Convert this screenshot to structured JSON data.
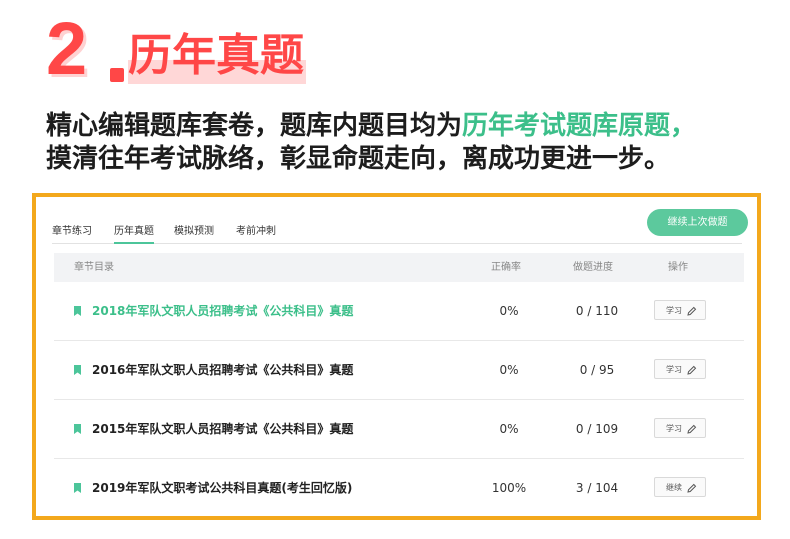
{
  "heading": {
    "number": "2",
    "title": "历年真题"
  },
  "description": {
    "line1_before": "精心编辑题库套卷，题库内题目均为",
    "line1_highlight": "历年考试题库原题，",
    "line2": "摸清往年考试脉络，彰显命题走向，离成功更进一步。",
    "highlight_color": "#3cbf8a"
  },
  "tabs": [
    {
      "label": "章节练习",
      "active": false
    },
    {
      "label": "历年真题",
      "active": true
    },
    {
      "label": "模拟预测",
      "active": false
    },
    {
      "label": "考前冲刺",
      "active": false
    }
  ],
  "continue_button": "继续上次做题",
  "table": {
    "headers": {
      "chapter": "章节目录",
      "accuracy": "正确率",
      "progress": "做题进度",
      "action": "操作"
    },
    "rows": [
      {
        "name": "2018年军队文职人员招聘考试《公共科目》真题",
        "accuracy": "0%",
        "progress": "0 / 110",
        "action": "学习",
        "current": true
      },
      {
        "name": "2016年军队文职人员招聘考试《公共科目》真题",
        "accuracy": "0%",
        "progress": "0 / 95",
        "action": "学习",
        "current": false
      },
      {
        "name": "2015年军队文职人员招聘考试《公共科目》真题",
        "accuracy": "0%",
        "progress": "0 / 109",
        "action": "学习",
        "current": false
      },
      {
        "name": "2019年军队文职考试公共科目真题(考生回忆版)",
        "accuracy": "100%",
        "progress": "3 / 104",
        "action": "继续",
        "current": false
      }
    ]
  },
  "colors": {
    "accent_red": "#ff4747",
    "accent_green": "#5cc99d",
    "panel_border": "#f3a81c"
  },
  "icons": {
    "row_marker": "bookmark-icon",
    "action_icon": "pencil-icon"
  }
}
